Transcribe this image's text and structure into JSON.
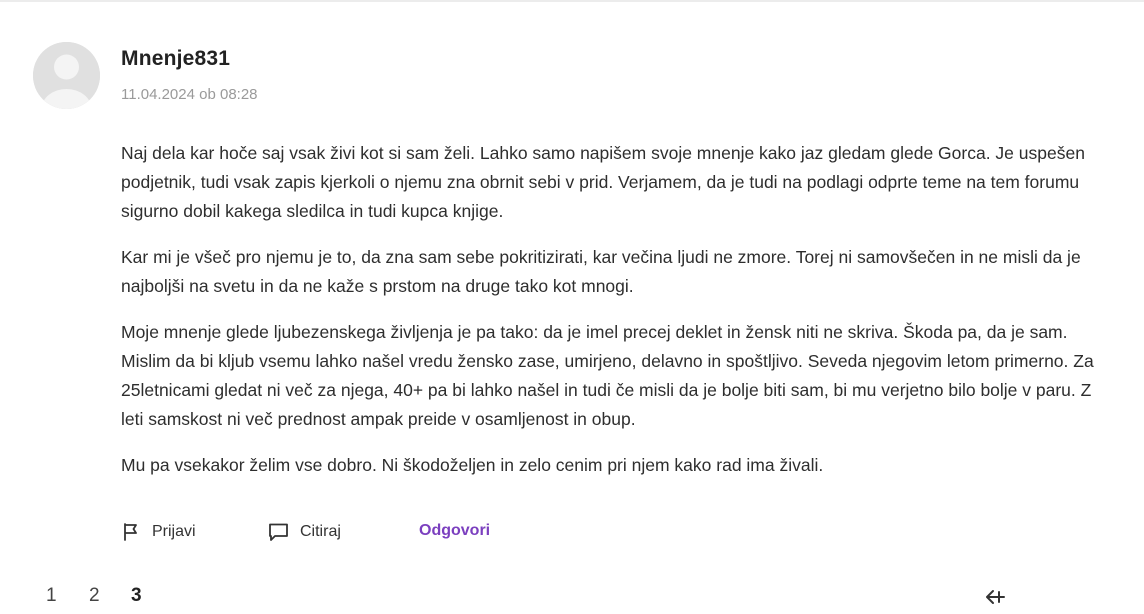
{
  "comment": {
    "author": "Mnenje831",
    "date": "11.04.2024 ob 08:28",
    "paragraphs": [
      "Naj dela kar hoče saj vsak živi kot si sam želi. Lahko samo napišem svoje mnenje kako jaz gledam glede Gorca. Je uspešen podjetnik, tudi vsak zapis kjerkoli o njemu zna obrnit sebi v prid. Verjamem, da je tudi na podlagi odprte teme na tem forumu sigurno dobil kakega sledilca in tudi kupca knjige.",
      "Kar mi je všeč pro njemu je to, da zna sam sebe pokritizirati, kar večina ljudi ne zmore. Torej ni samovšečen in ne misli da je najboljši na svetu in da ne kaže s prstom na druge tako kot mnogi.",
      "Moje mnenje glede ljubezenskega življenja je pa tako: da je imel precej deklet in žensk niti ne skriva. Škoda pa, da je sam. Mislim da bi kljub vsemu lahko našel vredu žensko zase, umirjeno, delavno in spoštljivo. Seveda njegovim letom primerno. Za 25letnicami gledat ni več za njega, 40+ pa bi lahko našel in tudi če misli da je bolje biti sam, bi mu verjetno bilo bolje v paru. Z leti samskost ni več prednost ampak preide v osamljenost in obup.",
      "Mu pa vsekakor želim vse dobro. Ni škodoželjen in zelo cenim pri njem kako rad ima živali."
    ]
  },
  "actions": {
    "report_label": "Prijavi",
    "report_icon": "flag-icon",
    "quote_label": "Citiraj",
    "quote_icon": "comment-icon",
    "reply_label": "Odgovori",
    "reply_color": "#7b3fbf"
  },
  "pagination": {
    "pages": [
      "1",
      "2",
      "3"
    ],
    "current": "3",
    "back_icon": "arrow-left-icon"
  }
}
